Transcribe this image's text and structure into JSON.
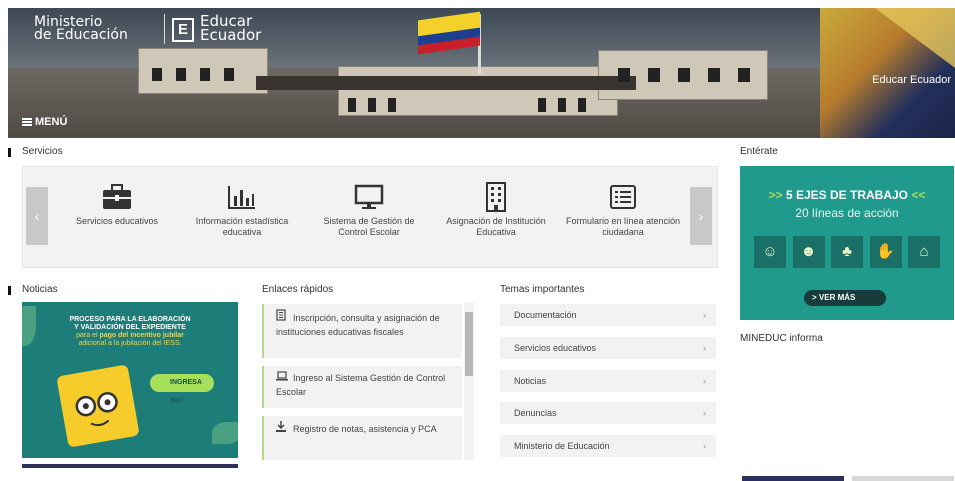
{
  "header": {
    "ministry_line1": "Ministerio",
    "ministry_line2": "de Educación",
    "brand_letter": "E",
    "brand_line1": "Educar",
    "brand_line2": "Ecuador",
    "side_label": "Educar Ecuador",
    "menu_label": "MENÚ"
  },
  "services": {
    "title": "Servicios",
    "items": [
      {
        "icon": "briefcase-icon",
        "label": "Servicios educativos"
      },
      {
        "icon": "bar-chart-icon",
        "label": "Información estadística educativa"
      },
      {
        "icon": "monitor-icon",
        "label": "Sistema de Gestión de Control Escolar"
      },
      {
        "icon": "building-icon",
        "label": "Asignación de Institución Educativa"
      },
      {
        "icon": "form-icon",
        "label": "Formulario en línea atención ciudadana"
      }
    ],
    "prev": "‹",
    "next": "›"
  },
  "news": {
    "title": "Noticias",
    "poster_line1": "PROCESO PARA LA ELABORACIÓN",
    "poster_line2": "Y VALIDACIÓN DEL EXPEDIENTE",
    "poster_line3a": "para el ",
    "poster_line3b": "pago del incentivo jubilar",
    "poster_line4": "adicional a la jubilación del IESS.",
    "ingresa_label": "INGRESA",
    "ingresa_sub": "aquí"
  },
  "links": {
    "title": "Enlaces rápidos",
    "items": [
      {
        "icon": "document-icon",
        "label": "Inscripción, consulta y asignación de instituciones educativas fiscales"
      },
      {
        "icon": "laptop-icon",
        "label": "Ingreso al Sistema Gestión de Control Escolar"
      },
      {
        "icon": "download-icon",
        "label": "Registro de notas, asistencia y PCA"
      }
    ]
  },
  "topics": {
    "title": "Temas importantes",
    "items": [
      "Documentación",
      "Servicios educativos",
      "Noticias",
      "Denuncias",
      "Ministerio de Educación"
    ],
    "chevron": "›"
  },
  "enterate": {
    "title": "Entérate",
    "banner_title": "5 EJES DE TRABAJO",
    "banner_arrows_left": ">>",
    "banner_arrows_right": "<<",
    "banner_subtitle": "20 líneas de acción",
    "button_label": "VER MÁS",
    "button_arrow": ">"
  },
  "mineduc": {
    "title": "MINEDUC informa"
  },
  "colors": {
    "accent_teal": "#1f9a8c",
    "accent_green": "#a6e05a",
    "navy": "#2b2f5e"
  }
}
